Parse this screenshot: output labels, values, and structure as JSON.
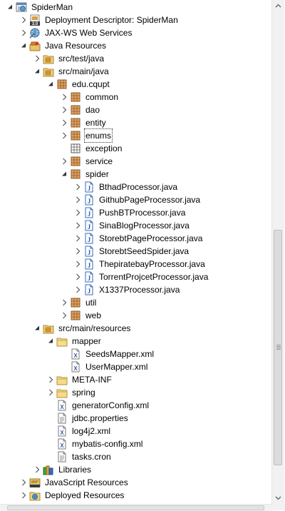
{
  "tree": [
    {
      "label": "SpiderMan",
      "depth": 0,
      "twisty": "open",
      "icon": "web-project-icon"
    },
    {
      "label": "Deployment Descriptor: SpiderMan",
      "depth": 1,
      "twisty": "closed",
      "icon": "deployment-descriptor-icon"
    },
    {
      "label": "JAX-WS Web Services",
      "depth": 1,
      "twisty": "closed",
      "icon": "web-services-icon"
    },
    {
      "label": "Java Resources",
      "depth": 1,
      "twisty": "open",
      "icon": "java-resources-icon"
    },
    {
      "label": "src/test/java",
      "depth": 2,
      "twisty": "closed",
      "icon": "source-folder-icon"
    },
    {
      "label": "src/main/java",
      "depth": 2,
      "twisty": "open",
      "icon": "source-folder-icon"
    },
    {
      "label": "edu.cqupt",
      "depth": 3,
      "twisty": "open",
      "icon": "package-icon"
    },
    {
      "label": "common",
      "depth": 4,
      "twisty": "closed",
      "icon": "package-icon"
    },
    {
      "label": "dao",
      "depth": 4,
      "twisty": "closed",
      "icon": "package-icon"
    },
    {
      "label": "entity",
      "depth": 4,
      "twisty": "closed",
      "icon": "package-icon"
    },
    {
      "label": "enums",
      "depth": 4,
      "twisty": "closed",
      "icon": "package-icon",
      "focused": true
    },
    {
      "label": "exception",
      "depth": 4,
      "twisty": "none",
      "icon": "empty-package-icon"
    },
    {
      "label": "service",
      "depth": 4,
      "twisty": "closed",
      "icon": "package-icon"
    },
    {
      "label": "spider",
      "depth": 4,
      "twisty": "open",
      "icon": "package-icon"
    },
    {
      "label": "BthadProcessor.java",
      "depth": 5,
      "twisty": "closed",
      "icon": "java-file-icon"
    },
    {
      "label": "GithubPageProcessor.java",
      "depth": 5,
      "twisty": "closed",
      "icon": "java-file-icon"
    },
    {
      "label": "PushBTProcessor.java",
      "depth": 5,
      "twisty": "closed",
      "icon": "java-file-icon"
    },
    {
      "label": "SinaBlogProcessor.java",
      "depth": 5,
      "twisty": "closed",
      "icon": "java-file-icon"
    },
    {
      "label": "StorebtPageProcessor.java",
      "depth": 5,
      "twisty": "closed",
      "icon": "java-file-icon"
    },
    {
      "label": "StorebtSeedSpider.java",
      "depth": 5,
      "twisty": "closed",
      "icon": "java-file-icon"
    },
    {
      "label": "ThepiratebayProcessor.java",
      "depth": 5,
      "twisty": "closed",
      "icon": "java-file-icon"
    },
    {
      "label": "TorrentProjcetProcessor.java",
      "depth": 5,
      "twisty": "closed",
      "icon": "java-file-icon"
    },
    {
      "label": "X1337Processor.java",
      "depth": 5,
      "twisty": "closed",
      "icon": "java-file-icon"
    },
    {
      "label": "util",
      "depth": 4,
      "twisty": "closed",
      "icon": "package-icon"
    },
    {
      "label": "web",
      "depth": 4,
      "twisty": "closed",
      "icon": "package-icon"
    },
    {
      "label": "src/main/resources",
      "depth": 2,
      "twisty": "open",
      "icon": "source-folder-icon"
    },
    {
      "label": "mapper",
      "depth": 3,
      "twisty": "open",
      "icon": "folder-icon"
    },
    {
      "label": "SeedsMapper.xml",
      "depth": 4,
      "twisty": "none",
      "icon": "xml-file-icon"
    },
    {
      "label": "UserMapper.xml",
      "depth": 4,
      "twisty": "none",
      "icon": "xml-file-icon"
    },
    {
      "label": "META-INF",
      "depth": 3,
      "twisty": "closed",
      "icon": "folder-icon"
    },
    {
      "label": "spring",
      "depth": 3,
      "twisty": "closed",
      "icon": "folder-icon"
    },
    {
      "label": "generatorConfig.xml",
      "depth": 3,
      "twisty": "none",
      "icon": "xml-file-icon"
    },
    {
      "label": "jdbc.properties",
      "depth": 3,
      "twisty": "none",
      "icon": "text-file-icon"
    },
    {
      "label": "log4j2.xml",
      "depth": 3,
      "twisty": "none",
      "icon": "xml-file-icon"
    },
    {
      "label": "mybatis-config.xml",
      "depth": 3,
      "twisty": "none",
      "icon": "xml-file-icon"
    },
    {
      "label": "tasks.cron",
      "depth": 3,
      "twisty": "none",
      "icon": "text-file-icon"
    },
    {
      "label": "Libraries",
      "depth": 2,
      "twisty": "closed",
      "icon": "libraries-icon"
    },
    {
      "label": "JavaScript Resources",
      "depth": 1,
      "twisty": "closed",
      "icon": "javascript-resources-icon"
    },
    {
      "label": "Deployed Resources",
      "depth": 1,
      "twisty": "closed",
      "icon": "deployed-resources-icon"
    }
  ]
}
